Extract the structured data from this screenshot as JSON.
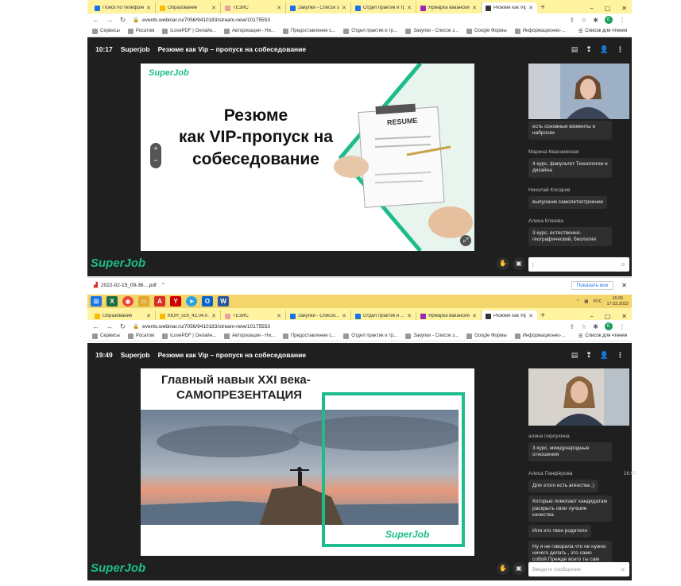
{
  "top": {
    "tabs": [
      {
        "title": "Поиск по телефоно...",
        "color": "#1a73e8"
      },
      {
        "title": "Образование",
        "color": "#fbbc04"
      },
      {
        "title": "ТЕЗИС",
        "color": "#e8a0a0"
      },
      {
        "title": "Закупки - Список зак...",
        "color": "#1a73e8"
      },
      {
        "title": "Отдел практик и труд...",
        "color": "#1a73e8"
      },
      {
        "title": "Ярмарка вакансий Н...",
        "color": "#9c27b0"
      },
      {
        "title": "Резюме как Vip - ...",
        "color": "#333333"
      }
    ],
    "url": "events.webinar.ru/7056/9410183/stream-new/10175553",
    "bookmarks": [
      "Сервисы",
      "Росатом",
      "iLovePDF | Онлайн...",
      "Авторизация - Ни...",
      "Предоставление с...",
      "Отдел практик и тр...",
      "Закупки - Список з...",
      "Google Формы",
      "Информационно-..."
    ],
    "reading_list": "Список для чтения",
    "time": "10:17",
    "brand": "Superjob",
    "webinar_title": "Резюме как Vip – пропуск на собеседование",
    "slide_logo": "SuperJob",
    "slide_lines": [
      "Резюме",
      "как VIP-пропуск на",
      "собеседование"
    ],
    "resume_label": "RESUME",
    "chat": [
      {
        "name": "",
        "text": "есть основные моменты и наброски"
      },
      {
        "name": "Марина Квасневская",
        "text": "4 курс, факультет Технологии и дизайна"
      },
      {
        "name": "Николай Косарев",
        "text": "выпускник самолетостроение"
      },
      {
        "name": "Алина Клюева",
        "text": "3 курс, естественно-географический, биология"
      }
    ],
    "footer_logo": "SuperJob"
  },
  "downloads": {
    "file": "2022-02-15_09-36....pdf",
    "show_all": "Показать все"
  },
  "taskbar": {
    "lang": "РУС",
    "time": "16:05",
    "date": "17.02.2022"
  },
  "bottom": {
    "tabs": [
      {
        "title": "Образование",
        "color": "#fbbc04"
      },
      {
        "title": "КЮН_осh_42.04.0...",
        "color": "#fbbc04"
      },
      {
        "title": "ТЕЗИС",
        "color": "#e8a0a0"
      },
      {
        "title": "Закупки - Список...",
        "color": "#1a73e8"
      },
      {
        "title": "Отдел практик и ...",
        "color": "#1a73e8"
      },
      {
        "title": "Ярмарка вакансий...",
        "color": "#9c27b0"
      },
      {
        "title": "Резюме как Vip - ...",
        "color": "#333333"
      }
    ],
    "url": "events.webinar.ru/7056/9410183/stream-new/10175553",
    "time": "19:49",
    "brand": "Superjob",
    "webinar_title": "Резюме как Vip – пропуск на собеседование",
    "slide_title_1": "Главный навык XXI века-",
    "slide_title_2": "САМОПРЕЗЕНТАЦИЯ",
    "slide_logo": "SuperJob",
    "chat_top": {
      "name": "алина перлухина",
      "text": "3 курс, международные отношения"
    },
    "chat_author": "Алиса Панфёрова",
    "chat_time": "16:07",
    "chat_msgs": [
      "Для этого есть агенства ;)",
      "Которые помогают кандидатам раскрыть свои лучшие качества",
      "Или это твои родители",
      "Ну я не говорила что не нужно ничего делать , это само собой.Прежде всего ты сам"
    ],
    "input_placeholder": "Введите сообщение",
    "footer_logo": "SuperJob"
  }
}
